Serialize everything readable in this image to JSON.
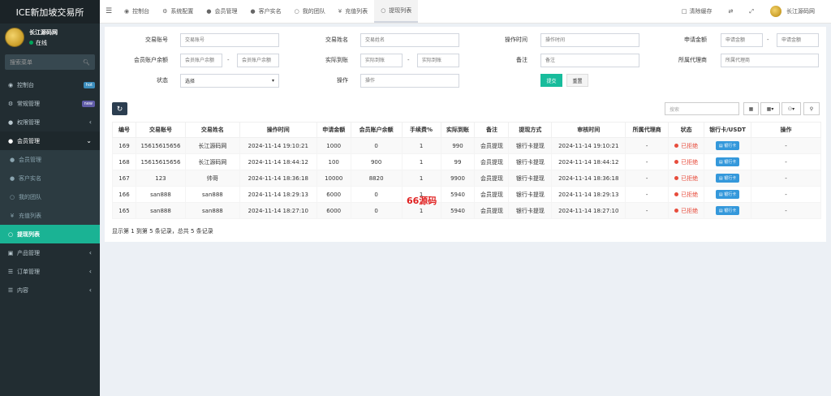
{
  "app": {
    "title": "ICE新加坡交易所"
  },
  "user": {
    "name": "长江源码网",
    "status": "在线"
  },
  "sidebar": {
    "search_placeholder": "搜索菜单",
    "items": [
      {
        "label": "控制台",
        "icon": "dashboard-icon",
        "badge": "hot"
      },
      {
        "label": "常规管理",
        "icon": "cogs-icon",
        "badge": "new"
      },
      {
        "label": "权限管理",
        "icon": "group-icon"
      },
      {
        "label": "会员管理",
        "icon": "user-icon"
      },
      {
        "label": "会员管理",
        "icon": "user-icon"
      },
      {
        "label": "客户实名",
        "icon": "user-icon"
      },
      {
        "label": "我的团队",
        "icon": "circle-icon"
      },
      {
        "label": "充值列表",
        "icon": "yen-icon"
      },
      {
        "label": "提现列表",
        "icon": "circle-icon"
      },
      {
        "label": "产品管理",
        "icon": "briefcase-icon"
      },
      {
        "label": "订单管理",
        "icon": "list-icon"
      },
      {
        "label": "内容",
        "icon": "list-icon"
      }
    ]
  },
  "topbar": {
    "tabs": [
      "控制台",
      "系统配置",
      "会员管理",
      "客户实名",
      "我的团队",
      "充值列表",
      "提现列表"
    ],
    "clear_cache": "清除缓存",
    "user_name": "长江源码网"
  },
  "filters": {
    "trade_account": {
      "label": "交易账号",
      "placeholder": "交易账号"
    },
    "trade_name": {
      "label": "交易姓名",
      "placeholder": "交易姓名"
    },
    "op_time": {
      "label": "操作时间",
      "placeholder": "操作时间"
    },
    "apply_amount": {
      "label": "申请金额",
      "placeholder": "申请金额"
    },
    "member_balance": {
      "label": "会员账户余额",
      "placeholder": "会员账户余额"
    },
    "actual": {
      "label": "实际到账",
      "placeholder": "实际到账"
    },
    "remark": {
      "label": "备注",
      "placeholder": "备注"
    },
    "agent": {
      "label": "所属代理商",
      "placeholder": "所属代理商"
    },
    "status": {
      "label": "状态",
      "value": "选择"
    },
    "operation": {
      "label": "操作",
      "placeholder": "操作"
    },
    "submit": "提交",
    "reset": "重置"
  },
  "toolbar": {
    "search_placeholder": "搜索"
  },
  "table": {
    "headers": [
      "编号",
      "交易账号",
      "交易姓名",
      "操作时间",
      "申请金额",
      "会员账户余额",
      "手续费%",
      "实际到账",
      "备注",
      "提现方式",
      "审核时间",
      "所属代理商",
      "状态",
      "银行卡/USDT",
      "操作"
    ],
    "rows": [
      [
        "169",
        "15615615656",
        "长江源码网",
        "2024-11-14 19:10:21",
        "1000",
        "0",
        "1",
        "990",
        "会员提现",
        "银行卡提现",
        "2024-11-14 19:10:21",
        "-",
        "已拒绝",
        "银行卡",
        "-"
      ],
      [
        "168",
        "15615615656",
        "长江源码网",
        "2024-11-14 18:44:12",
        "100",
        "900",
        "1",
        "99",
        "会员提现",
        "银行卡提现",
        "2024-11-14 18:44:12",
        "-",
        "已拒绝",
        "银行卡",
        "-"
      ],
      [
        "167",
        "123",
        "帅哥",
        "2024-11-14 18:36:18",
        "10000",
        "8820",
        "1",
        "9900",
        "会员提现",
        "银行卡提现",
        "2024-11-14 18:36:18",
        "-",
        "已拒绝",
        "银行卡",
        "-"
      ],
      [
        "166",
        "san888",
        "san888",
        "2024-11-14 18:29:13",
        "6000",
        "0",
        "1",
        "5940",
        "会员提现",
        "银行卡提现",
        "2024-11-14 18:29:13",
        "-",
        "已拒绝",
        "银行卡",
        "-"
      ],
      [
        "165",
        "san888",
        "san888",
        "2024-11-14 18:27:10",
        "6000",
        "0",
        "1",
        "5940",
        "会员提现",
        "银行卡提现",
        "2024-11-14 18:27:10",
        "-",
        "已拒绝",
        "银行卡",
        "-"
      ]
    ],
    "footer": "显示第 1 到第 5 条记录，总共 5 条记录"
  },
  "watermark": "66源码"
}
